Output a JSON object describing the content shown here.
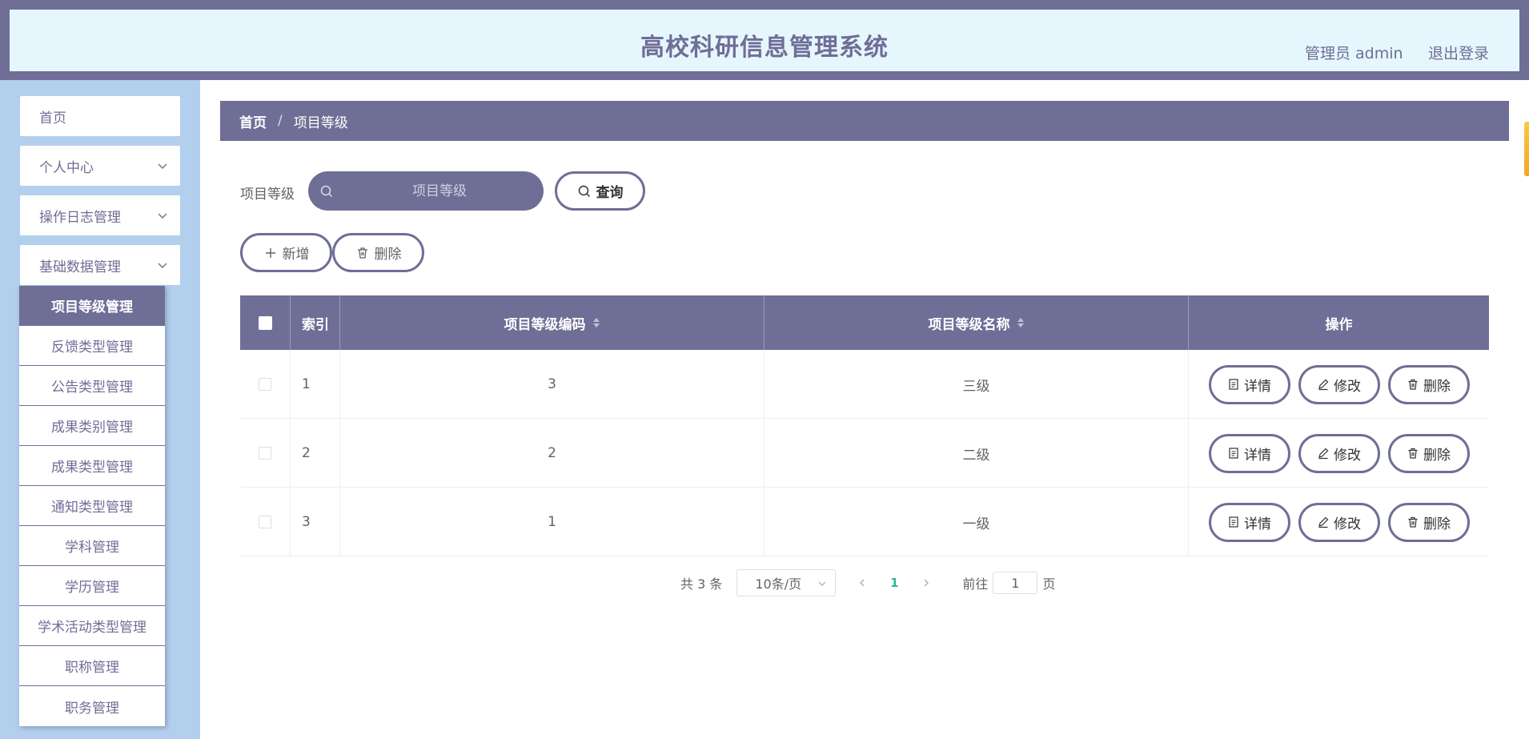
{
  "header": {
    "title": "高校科研信息管理系统",
    "admin": "管理员 admin",
    "logout": "退出登录"
  },
  "sidebar": {
    "items": [
      {
        "label": "首页"
      },
      {
        "label": "个人中心"
      },
      {
        "label": "操作日志管理"
      },
      {
        "label": "基础数据管理"
      }
    ],
    "submenu": [
      "项目等级管理",
      "反馈类型管理",
      "公告类型管理",
      "成果类别管理",
      "成果类型管理",
      "通知类型管理",
      "学科管理",
      "学历管理",
      "学术活动类型管理",
      "职称管理",
      "职务管理"
    ],
    "active_submenu": "项目等级管理"
  },
  "breadcrumb": {
    "home": "首页",
    "separator": "/",
    "current": "项目等级"
  },
  "search": {
    "label": "项目等级",
    "placeholder": "项目等级",
    "query_button": "查询"
  },
  "actions": {
    "add": "新增",
    "delete": "删除"
  },
  "table": {
    "headers": {
      "index": "索引",
      "code": "项目等级编码",
      "name": "项目等级名称",
      "ops": "操作"
    },
    "rows": [
      {
        "index": "1",
        "code": "3",
        "name": "三级"
      },
      {
        "index": "2",
        "code": "2",
        "name": "二级"
      },
      {
        "index": "3",
        "code": "1",
        "name": "一级"
      }
    ],
    "row_buttons": {
      "detail": "详情",
      "edit": "修改",
      "delete": "删除"
    }
  },
  "pagination": {
    "total": "共 3 条",
    "page_size": "10条/页",
    "current_page": "1",
    "goto_label": "前往",
    "goto_value": "1",
    "page_suffix": "页"
  },
  "colors": {
    "primary": "#6f6e96",
    "header_bg": "#e6f6fd",
    "sidebar_bg": "#b3cfee",
    "page_active": "#2bb596"
  }
}
